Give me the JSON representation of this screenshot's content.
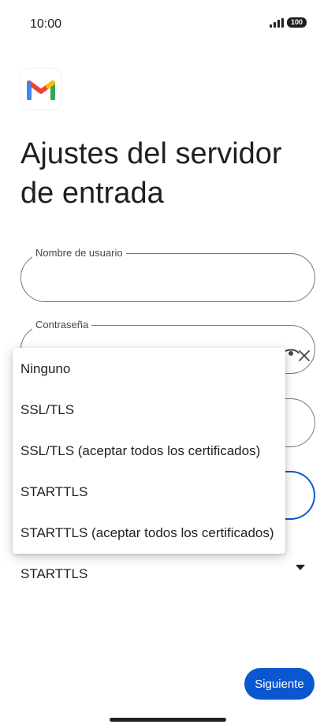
{
  "status_bar": {
    "time": "10:00",
    "battery": "100"
  },
  "page": {
    "title": "Ajustes del servidor de entrada"
  },
  "form": {
    "username": {
      "label": "Nombre de usuario",
      "value": ""
    },
    "password": {
      "label": "Contraseña",
      "value": ""
    },
    "security": {
      "selected": "STARTTLS"
    }
  },
  "dropdown": {
    "options": [
      "Ninguno",
      "SSL/TLS",
      "SSL/TLS (aceptar todos los certificados)",
      "STARTTLS",
      "STARTTLS (aceptar todos los certificados)"
    ]
  },
  "actions": {
    "next_label": "Siguiente"
  },
  "colors": {
    "accent": "#0b57d0",
    "text": "#1f1f1f",
    "outline": "#747775"
  }
}
